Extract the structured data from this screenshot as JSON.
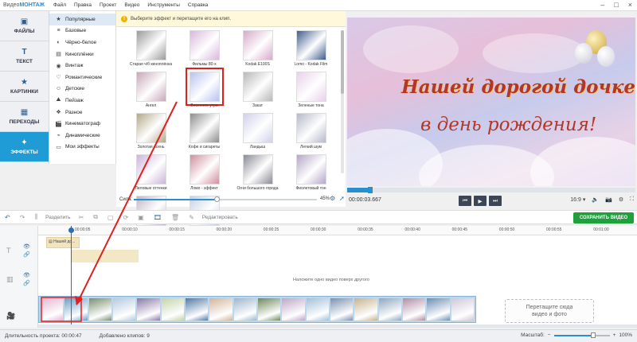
{
  "app": {
    "name_prefix": "Видео",
    "name_brand": "МОНТАЖ"
  },
  "menu": [
    "Файл",
    "Правка",
    "Проект",
    "Видео",
    "Инструменты",
    "Справка"
  ],
  "nav": [
    {
      "label": "ФАЙЛЫ",
      "icon": "image-icon"
    },
    {
      "label": "ТЕКСТ",
      "icon": "text-icon"
    },
    {
      "label": "КАРТИНКИ",
      "icon": "star-icon"
    },
    {
      "label": "ПЕРЕХОДЫ",
      "icon": "transitions-icon"
    },
    {
      "label": "ЭФФЕКТЫ",
      "icon": "magic-wand-icon",
      "active": true
    }
  ],
  "categories": [
    {
      "label": "Популярные",
      "icon": "star-icon",
      "active": true
    },
    {
      "label": "Базовые",
      "icon": "sliders-icon"
    },
    {
      "label": "Чёрно-белое",
      "icon": "contrast-icon"
    },
    {
      "label": "Киноплёнки",
      "icon": "film-icon"
    },
    {
      "label": "Винтаж",
      "icon": "camera-icon"
    },
    {
      "label": "Романтические",
      "icon": "heart-icon"
    },
    {
      "label": "Детские",
      "icon": "child-icon"
    },
    {
      "label": "Пейзаж",
      "icon": "landscape-icon"
    },
    {
      "label": "Разное",
      "icon": "misc-icon"
    },
    {
      "label": "Кинематограф",
      "icon": "clapper-icon"
    },
    {
      "label": "Динамические",
      "icon": "dynamic-icon"
    },
    {
      "label": "Мои эффекты",
      "icon": "folder-icon"
    }
  ],
  "hint_text": "Выберите эффект и перетащите его на клип.",
  "effects": [
    {
      "label": "Старая ч/б киноплёнка",
      "color": "#9a9a9a"
    },
    {
      "label": "Фильмы 80-х",
      "color": "#d8b8dc"
    },
    {
      "label": "Kodak E100S",
      "color": "#d7a9c9"
    },
    {
      "label": "Lomo - Kodak Film",
      "color": "#3f5d8c"
    },
    {
      "label": "Ангел",
      "color": "#c8a8b8"
    },
    {
      "label": "Весеннее утро",
      "color": "#b9c2ee",
      "selected": true
    },
    {
      "label": "Закат",
      "color": "#b8b8b8"
    },
    {
      "label": "Зеленые тона",
      "color": "#e8d0ea"
    },
    {
      "label": "Золотая осень",
      "color": "#b4a88a"
    },
    {
      "label": "Кофе и сигареты",
      "color": "#8d8d8d"
    },
    {
      "label": "Ландыш",
      "color": "#cfd2ea"
    },
    {
      "label": "Легкий шум",
      "color": "#b5b8c8"
    },
    {
      "label": "Лиловые оттенки",
      "color": "#cbb5d9"
    },
    {
      "label": "Ломо - эффект",
      "color": "#cf8f9e"
    },
    {
      "label": "Огни большого города",
      "color": "#8a8a96"
    },
    {
      "label": "Фиолетовый тон",
      "color": "#b5a6c8"
    },
    {
      "label": "",
      "color": "#c1b6c6"
    },
    {
      "label": "",
      "color": "#c6cfe6"
    }
  ],
  "strength": {
    "label": "Сила:",
    "value_pct": 45,
    "value_text": "45%"
  },
  "preview": {
    "line1": "Нашей дорогой дочке",
    "line2": "в день рождения!",
    "time": "00:00:03.667",
    "progress_pct": 8,
    "aspect": "16:9 ▾"
  },
  "toolbar": {
    "split": "Разделить",
    "edit": "Редактировать",
    "save": "СОХРАНИТЬ ВИДЕО"
  },
  "ruler": [
    "00:00:05",
    "00:00:10",
    "00:00:15",
    "00:00:20",
    "00:00:25",
    "00:00:30",
    "00:00:35",
    "00:00:40",
    "00:00:45",
    "00:00:50",
    "00:00:55",
    "00:01:00"
  ],
  "timeline": {
    "title_clip": "Нашей до...",
    "overlay_hint": "Наложите одно видео поверх другого",
    "drop_line1": "Перетащите сюда",
    "drop_line2": "видео и фото",
    "clip_colors": [
      "#e2b7d2",
      "#6e9ec4",
      "#7a8f6f",
      "#b6c9df",
      "#8a7aa8",
      "#c3d4a8",
      "#547aa6",
      "#d3b59a",
      "#9fb6cc",
      "#6f8a5c",
      "#bfa6c9",
      "#a3c1d8",
      "#7c90b0",
      "#c9b38c",
      "#8fa7bf",
      "#b18ea6",
      "#6c8fb3",
      "#d0c6da"
    ]
  },
  "status": {
    "duration_label": "Длительность проекта:",
    "duration": "00:00:47",
    "clips_label": "Добавлено клипов:",
    "clips": "9",
    "zoom_label": "Масштаб:",
    "zoom_pct": 70,
    "zoom_text": "100%"
  }
}
